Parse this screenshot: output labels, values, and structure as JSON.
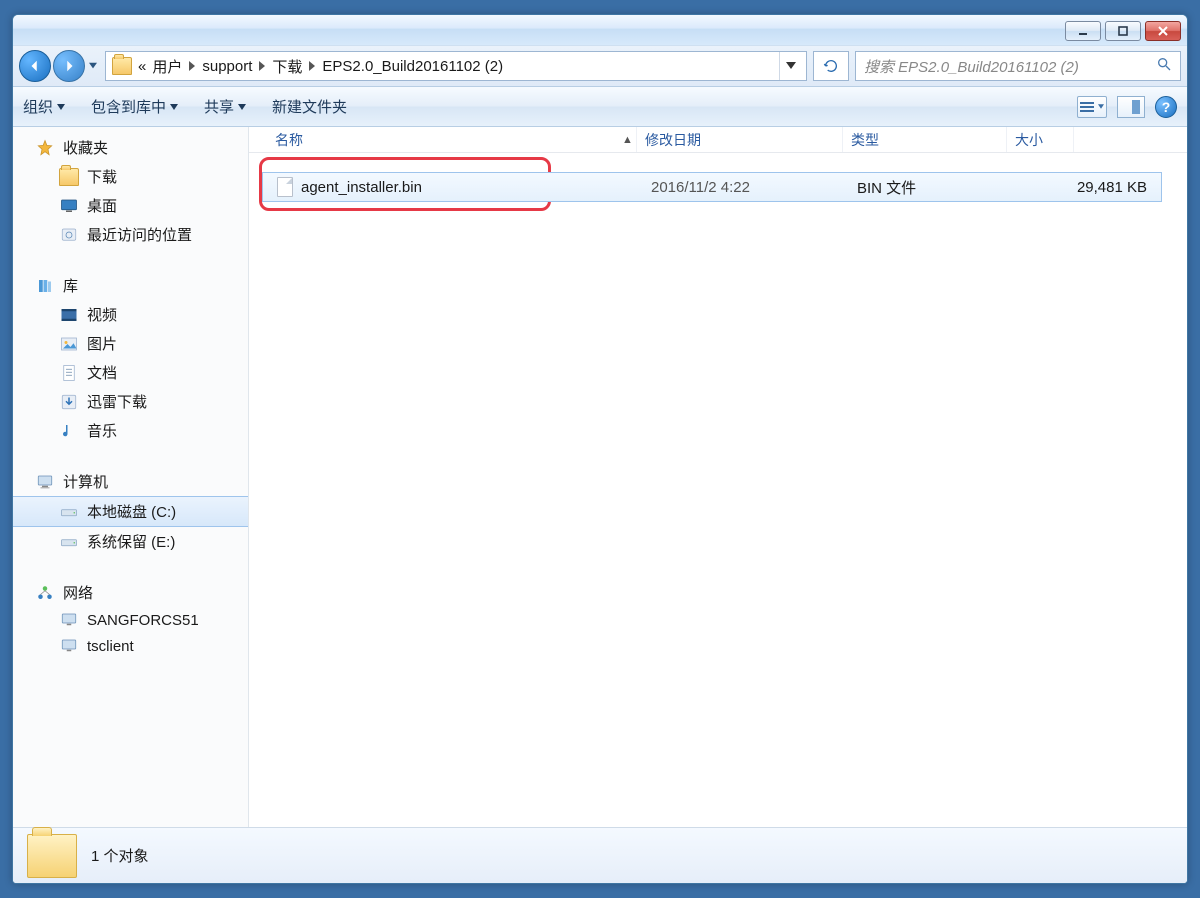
{
  "breadcrumb": {
    "overflow": "«",
    "parts": [
      "用户",
      "support",
      "下载",
      "EPS2.0_Build20161102 (2)"
    ]
  },
  "search": {
    "placeholder": "搜索 EPS2.0_Build20161102 (2)"
  },
  "toolbar": {
    "organize": "组织",
    "include": "包含到库中",
    "share": "共享",
    "newfolder": "新建文件夹"
  },
  "nav": {
    "favorites": {
      "label": "收藏夹",
      "items": [
        "下载",
        "桌面",
        "最近访问的位置"
      ]
    },
    "libraries": {
      "label": "库",
      "items": [
        "视频",
        "图片",
        "文档",
        "迅雷下载",
        "音乐"
      ]
    },
    "computer": {
      "label": "计算机",
      "items": [
        "本地磁盘 (C:)",
        "系统保留 (E:)"
      ],
      "selected_index": 0
    },
    "network": {
      "label": "网络",
      "items": [
        "SANGFORCS51",
        "tsclient"
      ]
    }
  },
  "columns": {
    "name": "名称",
    "modified": "修改日期",
    "type": "类型",
    "size": "大小"
  },
  "file": {
    "name": "agent_installer.bin",
    "modified": "2016/11/2 4:22",
    "type": "BIN 文件",
    "size": "29,481 KB"
  },
  "status": {
    "count": "1 个对象"
  },
  "help": "?"
}
